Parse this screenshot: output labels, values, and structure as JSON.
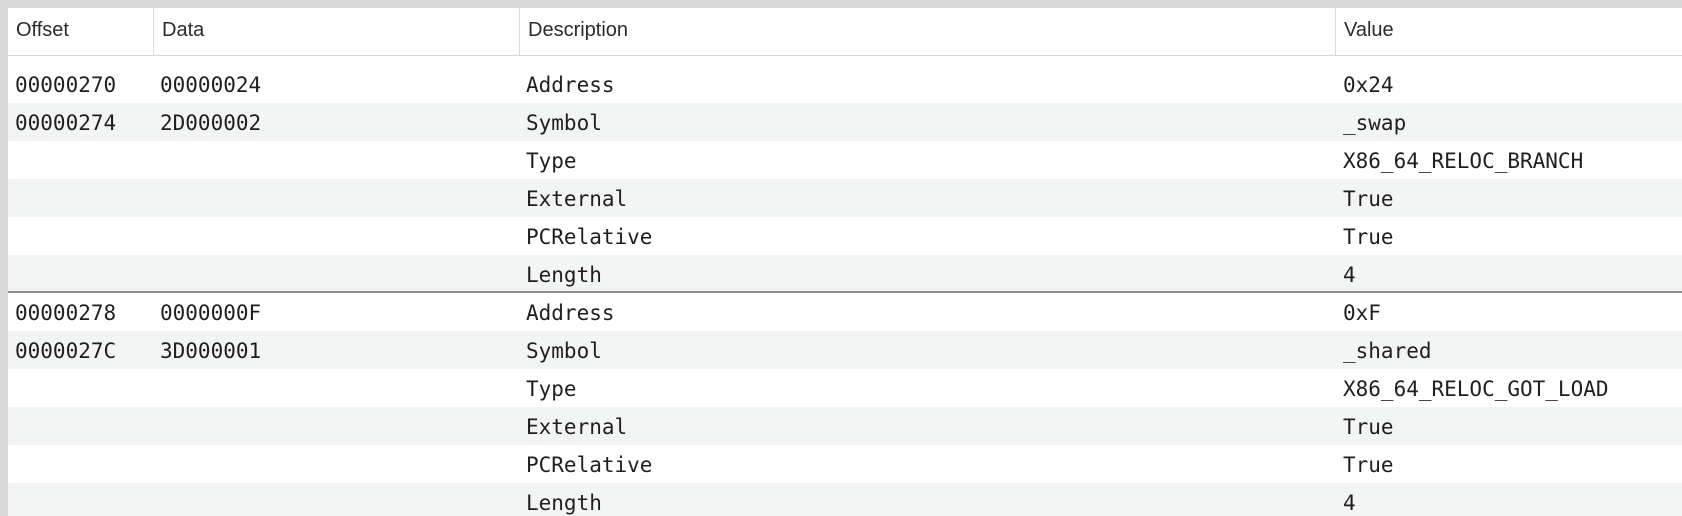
{
  "columns": {
    "offset": "Offset",
    "data": "Data",
    "description": "Description",
    "value": "Value"
  },
  "rows": [
    {
      "offset": "00000270",
      "data": "00000024",
      "description": "Address",
      "value": "0x24"
    },
    {
      "offset": "00000274",
      "data": "2D000002",
      "description": "Symbol",
      "value": "_swap"
    },
    {
      "offset": "",
      "data": "",
      "description": "Type",
      "value": "X86_64_RELOC_BRANCH"
    },
    {
      "offset": "",
      "data": "",
      "description": "External",
      "value": "True"
    },
    {
      "offset": "",
      "data": "",
      "description": "PCRelative",
      "value": "True"
    },
    {
      "offset": "",
      "data": "",
      "description": "Length",
      "value": "4"
    },
    {
      "offset": "00000278",
      "data": "0000000F",
      "description": "Address",
      "value": "0xF"
    },
    {
      "offset": "0000027C",
      "data": "3D000001",
      "description": "Symbol",
      "value": "_shared"
    },
    {
      "offset": "",
      "data": "",
      "description": "Type",
      "value": "X86_64_RELOC_GOT_LOAD"
    },
    {
      "offset": "",
      "data": "",
      "description": "External",
      "value": "True"
    },
    {
      "offset": "",
      "data": "",
      "description": "PCRelative",
      "value": "True"
    },
    {
      "offset": "",
      "data": "",
      "description": "Length",
      "value": "4"
    }
  ]
}
